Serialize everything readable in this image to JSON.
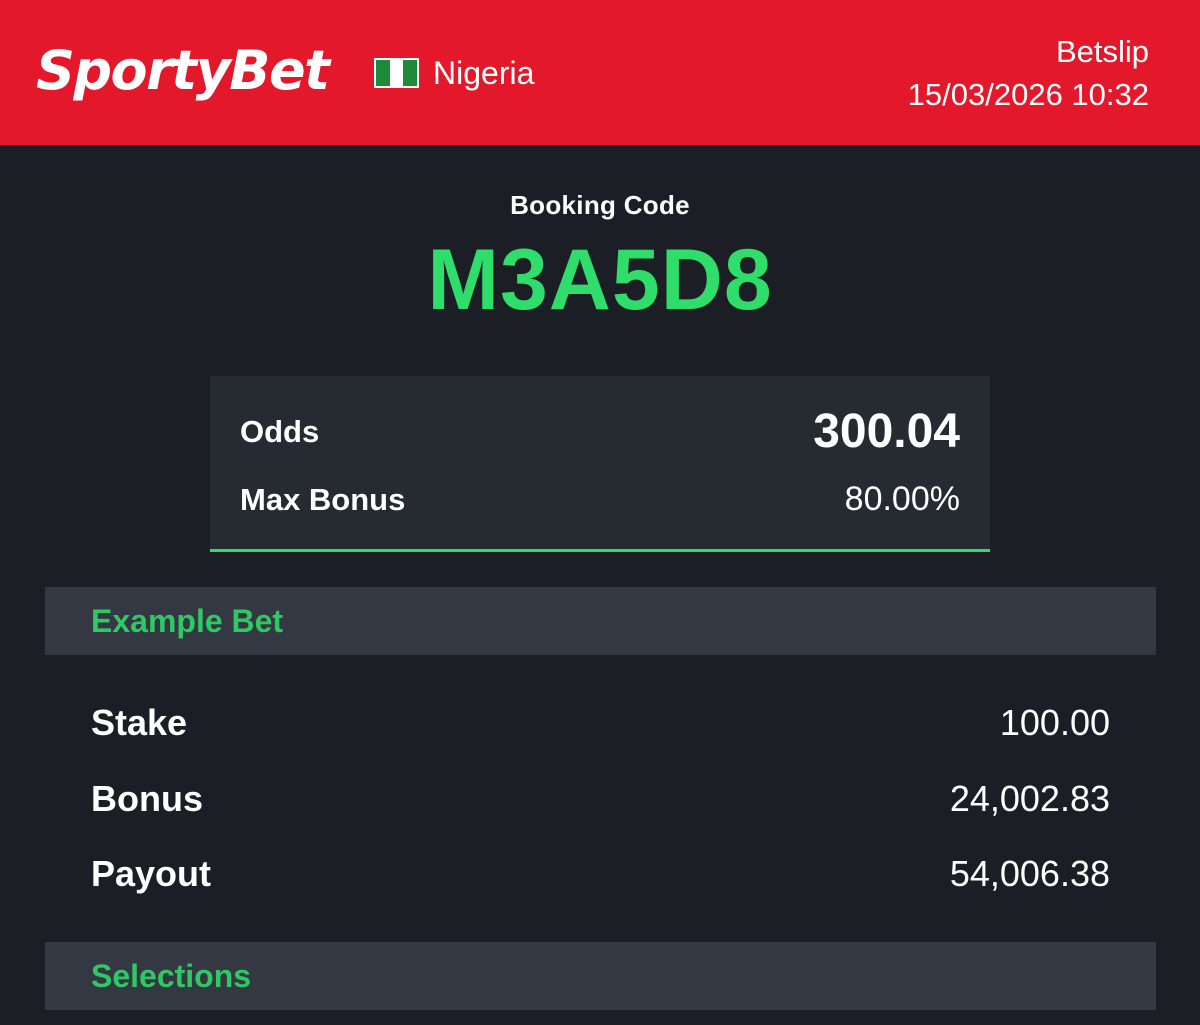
{
  "header": {
    "logo": "SportyBet",
    "country": "Nigeria",
    "title": "Betslip",
    "datetime": "15/03/2026 10:32"
  },
  "booking": {
    "label": "Booking Code",
    "code": "M3A5D8"
  },
  "summary": {
    "odds_label": "Odds",
    "odds_value": "300.04",
    "max_bonus_label": "Max Bonus",
    "max_bonus_value": "80.00%"
  },
  "example_bet": {
    "title": "Example Bet",
    "rows": [
      {
        "label": "Stake",
        "value": "100.00"
      },
      {
        "label": "Bonus",
        "value": "24,002.83"
      },
      {
        "label": "Payout",
        "value": "54,006.38"
      }
    ]
  },
  "selections": {
    "title": "Selections"
  },
  "colors": {
    "brand_red": "#e3192b",
    "accent_green": "#2fde6a",
    "background": "#1b1e24",
    "card": "#262a31",
    "section_bar": "#343842"
  },
  "icons": {
    "flag": "nigeria-flag-icon"
  }
}
